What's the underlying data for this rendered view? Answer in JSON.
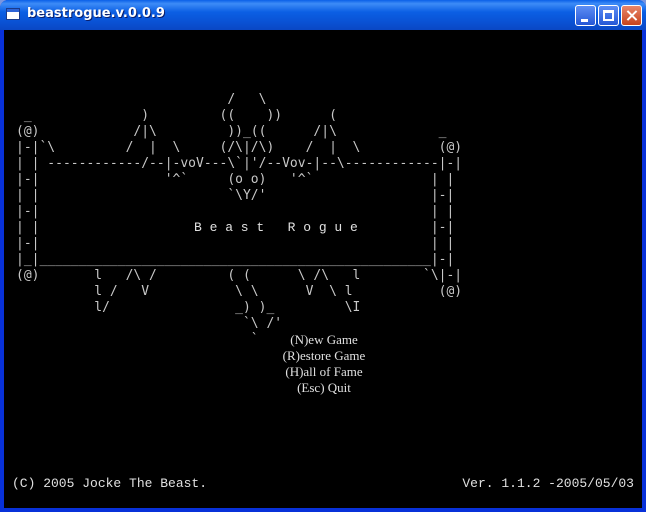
{
  "window": {
    "title": "beastrogue.v.0.0.9"
  },
  "art": {
    "lines": [
      "                           /   \\",
      " _              )         ((    ))      (",
      "(@)            /|\\         ))_((      /|\\             _",
      "|-|`\\         /  |  \\     (/\\|/\\)    /  |  \\          (@)",
      "| | ------------/--|-voV---\\`|'/--Vov-|--\\------------|-|",
      "|-|                '^`     (o o)   '^`               | |",
      "| |                        `\\Y/'                     |-|",
      "|-|                                                  | |",
      "| |                                                  |-|",
      "|-|                                                  | |",
      "|_|__________________________________________________|-|",
      "(@)       l   /\\ /         ( (      \\ /\\   l        `\\|-|",
      "          l /   V           \\ \\      V  \\ l           (@)",
      "          l/                _) )_         \\I",
      "                             `\\ /'",
      "                              `"
    ]
  },
  "game_title": "B e a s t   R o g u e",
  "menu": {
    "new_game": "(N)ew Game",
    "restore_game": "(R)estore Game",
    "hall_of_fame": "(H)all of Fame",
    "quit": "(Esc) Quit"
  },
  "footer": {
    "copyright": "(C) 2005 Jocke The Beast.",
    "version": "Ver. 1.1.2 -2005/05/03"
  }
}
